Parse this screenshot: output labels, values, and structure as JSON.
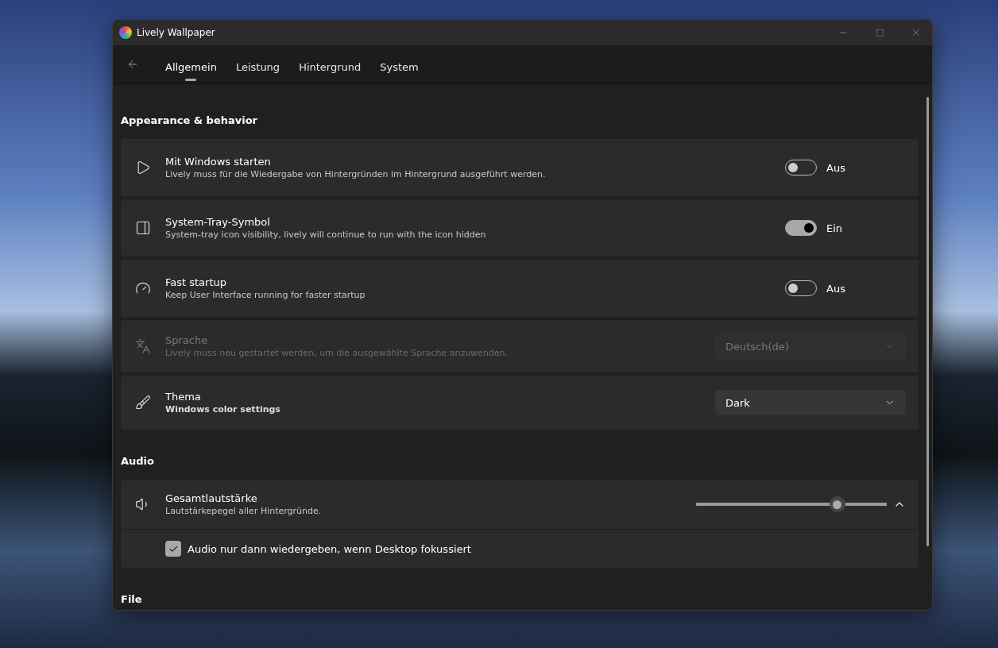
{
  "window": {
    "title": "Lively Wallpaper"
  },
  "tabs": [
    {
      "label": "Allgemein",
      "selected": true
    },
    {
      "label": "Leistung",
      "selected": false
    },
    {
      "label": "Hintergrund",
      "selected": false
    },
    {
      "label": "System",
      "selected": false
    }
  ],
  "sections": [
    {
      "title": "Appearance & behavior",
      "items": [
        {
          "kind": "toggle",
          "title": "Mit Windows starten",
          "description": "Lively muss für die Wiedergabe von Hintergründen im Hintergrund ausgeführt werden.",
          "disabled": false,
          "description_bold": false,
          "on": false,
          "state_label": "Aus"
        },
        {
          "kind": "toggle",
          "title": "System-Tray-Symbol",
          "description": "System-tray icon visibility, lively will continue to run with the icon hidden",
          "disabled": false,
          "description_bold": false,
          "on": true,
          "state_label": "Ein"
        },
        {
          "kind": "toggle",
          "title": "Fast startup",
          "description": "Keep User Interface running for faster startup",
          "disabled": false,
          "description_bold": false,
          "on": false,
          "state_label": "Aus"
        },
        {
          "kind": "dropdown",
          "title": "Sprache",
          "description": "Lively muss neu gestartet werden, um die ausgewählte Sprache anzuwenden.",
          "disabled": true,
          "description_bold": false,
          "value": "Deutsch(de)"
        },
        {
          "kind": "dropdown",
          "title": "Thema",
          "description": "Windows color settings",
          "disabled": false,
          "description_bold": true,
          "value": "Dark"
        }
      ]
    },
    {
      "title": "Audio",
      "items": [
        {
          "kind": "slider",
          "title": "Gesamtlautstärke",
          "description": "Lautstärkepegel aller Hintergründe.",
          "disabled": false,
          "description_bold": false,
          "level": 0.74,
          "expanded": true,
          "sub": {
            "label": "Audio nur dann wiedergeben, wenn Desktop fokussiert",
            "checked": true
          }
        }
      ]
    },
    {
      "title": "File"
    }
  ]
}
